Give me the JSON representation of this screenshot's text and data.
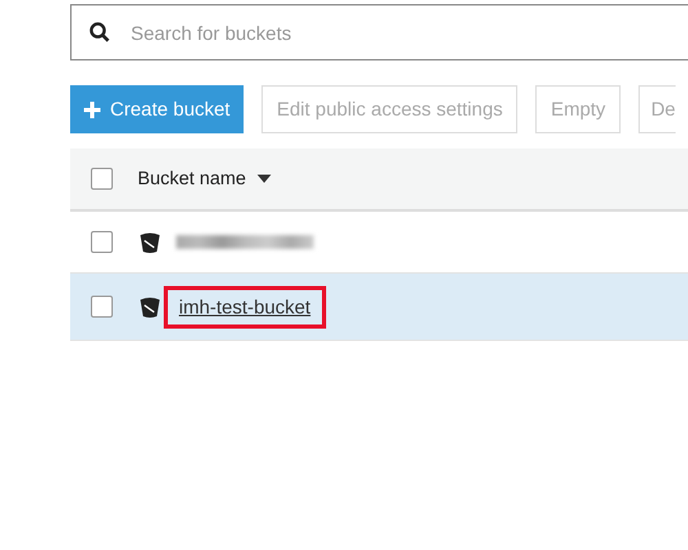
{
  "search": {
    "placeholder": "Search for buckets"
  },
  "toolbar": [
    {
      "label": "Create bucket",
      "kind": "primary"
    },
    {
      "label": "Edit public access settings",
      "kind": "disabled"
    },
    {
      "label": "Empty",
      "kind": "disabled"
    },
    {
      "label": "De",
      "kind": "disabled"
    }
  ],
  "table": {
    "all_checked": false,
    "columns": [
      {
        "label": "Bucket name",
        "sorted": true
      }
    ],
    "rows": [
      {
        "kind": "redacted",
        "selected": false,
        "checked": false
      },
      {
        "kind": "name",
        "name": "imh-test-bucket",
        "selected": true,
        "checked": false,
        "highlighted": true
      }
    ]
  }
}
